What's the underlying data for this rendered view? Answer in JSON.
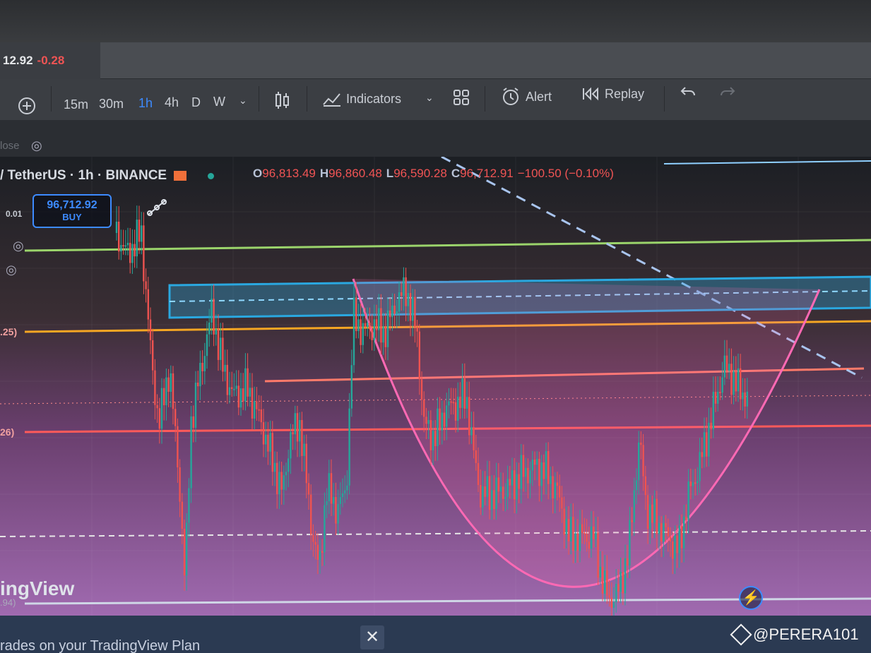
{
  "tab": {
    "price": "12.92",
    "change": "-0.28"
  },
  "toolbar": {
    "intervals": [
      "15m",
      "30m",
      "1h",
      "4h",
      "D",
      "W"
    ],
    "active_interval": "1h",
    "indicators_label": "Indicators",
    "alert_label": "Alert",
    "replay_label": "Replay"
  },
  "subbar": {
    "hidden_label": "lose"
  },
  "legend": {
    "symbol": "/ TetherUS · 1h · BINANCE",
    "open_key": "O",
    "open": "96,813.49",
    "high_key": "H",
    "high": "96,860.48",
    "low_key": "L",
    "low": "96,590.28",
    "close_key": "C",
    "close": "96,712.91",
    "change": "−100.50 (−0.10%)"
  },
  "order": {
    "qty": "0.01",
    "price": "96,712.92",
    "side": "BUY"
  },
  "axis_labels": [
    ".25)",
    "26)"
  ],
  "watermark": {
    "brand": "ingView",
    "sub": ".94)"
  },
  "bottom": {
    "message": "rades on your TradingView Plan",
    "close": "✕"
  },
  "credit": "@PERERA101",
  "colors": {
    "up": "#26a69a",
    "down": "#ef5350",
    "accent": "#3d8bff",
    "zone_blue": "#2aa8e0",
    "line_orange": "#f5a623",
    "line_red": "#ff5a5a",
    "line_green": "#9bd46b",
    "cup_pink": "#ff69b4"
  }
}
